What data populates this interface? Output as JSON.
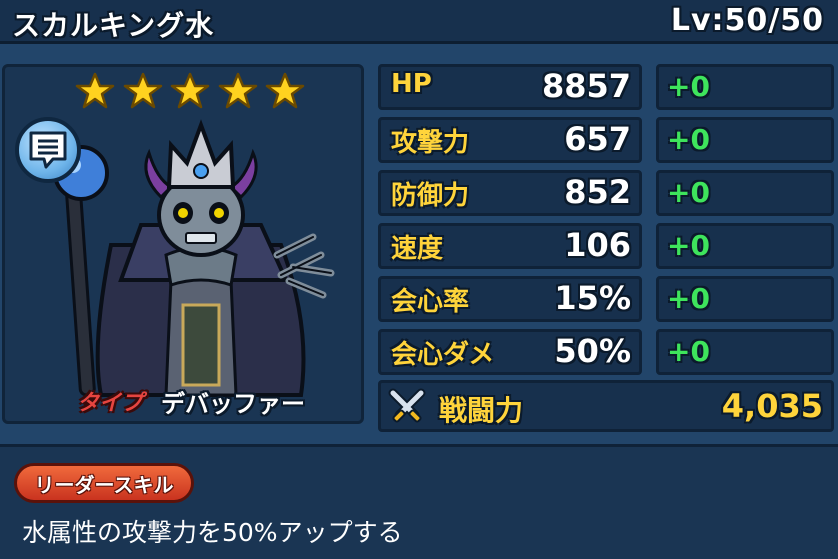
{
  "header": {
    "character_name": "スカルキング水",
    "level": "Lv:50/50"
  },
  "portrait": {
    "stars": 5,
    "type_label": "タイプ",
    "type_value": "デバッファー",
    "speech_icon": "speech-bubble-icon"
  },
  "stats": [
    {
      "name": "HP",
      "value": "8857",
      "bonus": "+0"
    },
    {
      "name": "攻撃力",
      "value": "657",
      "bonus": "+0"
    },
    {
      "name": "防御力",
      "value": "852",
      "bonus": "+0"
    },
    {
      "name": "速度",
      "value": "106",
      "bonus": "+0"
    },
    {
      "name": "会心率",
      "value": "15%",
      "bonus": "+0"
    },
    {
      "name": "会心ダメ",
      "value": "50%",
      "bonus": "+0"
    }
  ],
  "power": {
    "label": "戦闘力",
    "value": "4,035",
    "icon": "crossed-swords-icon"
  },
  "leader_skill": {
    "badge": "リーダースキル",
    "description": "水属性の攻撃力を50%アップする"
  },
  "colors": {
    "background": "#22456a",
    "stat_label": "#ffd43b",
    "bonus": "#3ee45c",
    "type_label": "#e64540",
    "skill_badge": "#e0492b"
  }
}
